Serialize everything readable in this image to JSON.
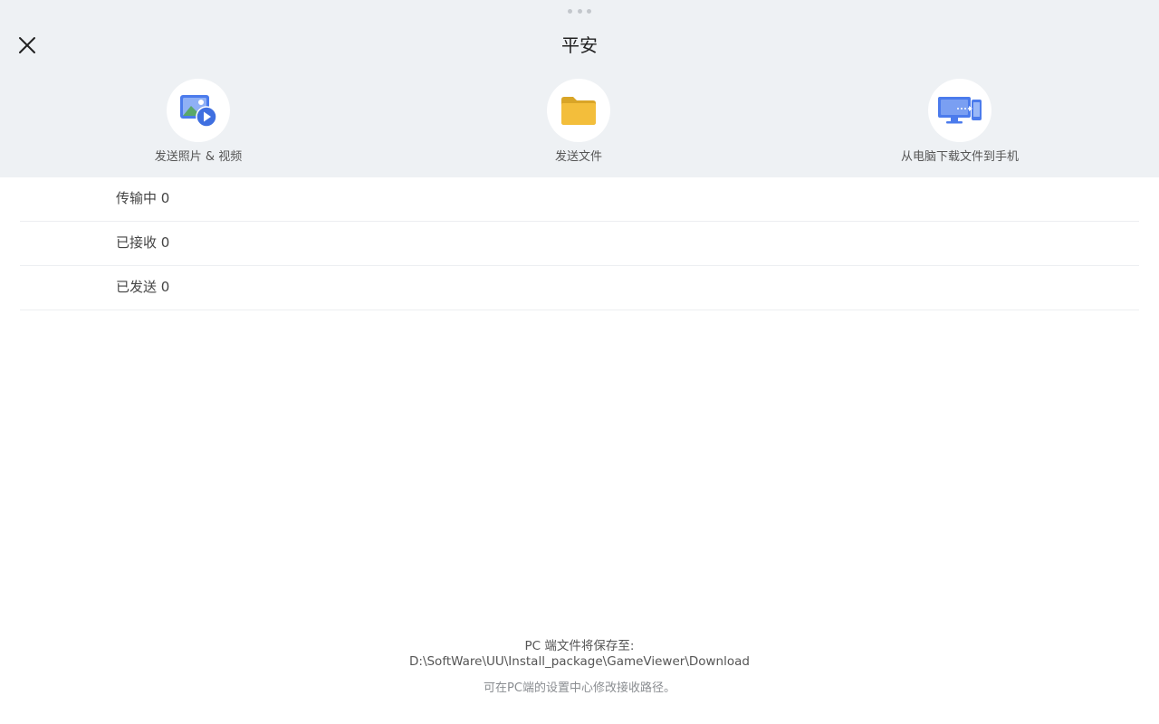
{
  "header": {
    "title": "平安",
    "close_icon": "close-icon"
  },
  "actions": [
    {
      "label": "发送照片 & 视频",
      "icon": "photo-video-icon"
    },
    {
      "label": "发送文件",
      "icon": "folder-icon"
    },
    {
      "label": "从电脑下载文件到手机",
      "icon": "pc-to-phone-icon"
    }
  ],
  "list": [
    {
      "label": "传输中 0"
    },
    {
      "label": "已接收 0"
    },
    {
      "label": "已发送 0"
    }
  ],
  "footer": {
    "save_label": "PC 端文件将保存至:",
    "save_path": "D:\\SoftWare\\UU\\Install_package\\GameViewer\\Download",
    "hint": "可在PC端的设置中心修改接收路径。"
  },
  "colors": {
    "panel_bg": "#eef1f4",
    "accent_blue": "#4b7bec",
    "folder_yellow": "#f3be3b",
    "photo_green": "#5aa86a"
  }
}
